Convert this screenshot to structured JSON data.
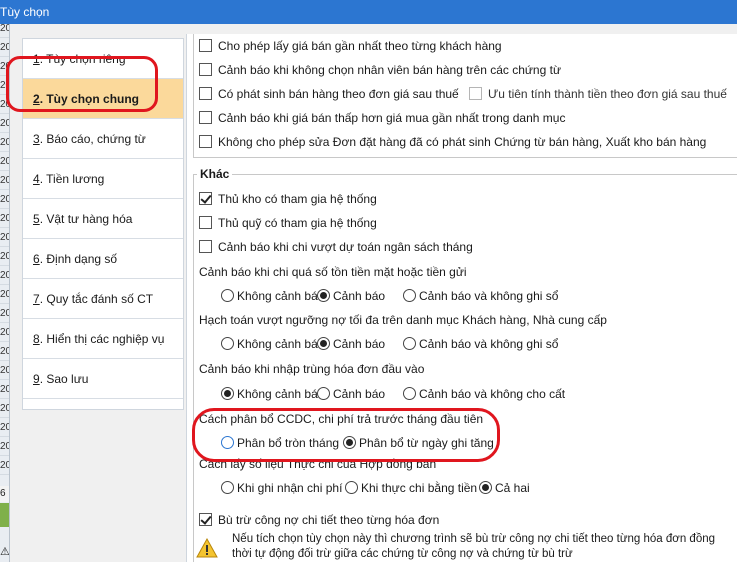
{
  "window": {
    "title": "Tùy chọn"
  },
  "background": {
    "cells": [
      "20",
      "20",
      "20",
      "20",
      "20",
      "20",
      "20",
      "20",
      "20",
      "20",
      "20",
      "20",
      "20",
      "20",
      "20",
      "20",
      "20",
      "20",
      "20",
      "20",
      "20",
      "20",
      "20",
      "20",
      "20"
    ],
    "number": "6"
  },
  "nav": {
    "items": [
      {
        "num": "1",
        "label": ". Tùy chọn riêng"
      },
      {
        "num": "2",
        "label": ". Tùy chọn chung"
      },
      {
        "num": "3",
        "label": ". Báo cáo, chứng từ"
      },
      {
        "num": "4",
        "label": ". Tiền lương"
      },
      {
        "num": "5",
        "label": ". Vật tư hàng hóa"
      },
      {
        "num": "6",
        "label": ". Định dạng số"
      },
      {
        "num": "7",
        "label": ". Quy tắc đánh số CT"
      },
      {
        "num": "8",
        "label": ". Hiển thị các nghiệp vụ"
      },
      {
        "num": "9",
        "label": ". Sao lưu"
      }
    ],
    "active_index": 1
  },
  "top_options": [
    {
      "label": "Cho phép lấy giá bán gần nhất theo từng khách hàng",
      "checked": false
    },
    {
      "label": "Cảnh báo khi không chọn nhân viên bán hàng trên các chứng từ",
      "checked": false
    },
    {
      "label": "Có phát sinh bán hàng theo đơn giá sau thuế",
      "checked": false
    },
    {
      "label": "Ưu tiên tính thành tiền theo đơn giá sau thuế",
      "checked": false,
      "disabled": true
    },
    {
      "label": "Cảnh báo khi giá bán thấp hơn giá mua gần nhất trong danh mục",
      "checked": false
    },
    {
      "label": "Không cho phép sửa Đơn đặt hàng đã có phát sinh Chứng từ bán hàng, Xuất kho bán hàng",
      "checked": false
    }
  ],
  "other": {
    "title": "Khác",
    "options": [
      {
        "label": "Thủ kho có tham gia hệ thống",
        "checked": true
      },
      {
        "label": "Thủ quỹ có tham gia hệ thống",
        "checked": false
      },
      {
        "label": "Cảnh báo khi chi vượt dự toán ngân sách tháng",
        "checked": false
      }
    ],
    "cash_warning": {
      "label": "Cảnh báo khi chi quá số tồn tiền mặt hoặc tiền gửi",
      "options": [
        "Không cảnh báo",
        "Cảnh báo",
        "Cảnh báo và không ghi sổ"
      ],
      "selected": 1
    },
    "debt_warning": {
      "label": "Hạch toán vượt ngưỡng nợ tối đa trên danh mục Khách hàng, Nhà cung cấp",
      "options": [
        "Không cảnh báo",
        "Cảnh báo",
        "Cảnh báo và không ghi sổ"
      ],
      "selected": 1
    },
    "invoice_warning": {
      "label": "Cảnh báo khi nhập trùng hóa đơn đầu vào",
      "options": [
        "Không cảnh báo",
        "Cảnh báo",
        "Cảnh báo và không cho cất"
      ],
      "selected": 0
    },
    "allocation": {
      "label": "Cách phân bổ CCDC, chi phí trả trước tháng đầu tiên",
      "options": [
        "Phân bổ tròn tháng",
        "Phân bổ từ ngày ghi tăng"
      ],
      "selected": 1
    },
    "contract": {
      "label": "Cách lấy số liệu Thực chi của Hợp đồng bán",
      "options": [
        "Khi ghi nhận chi phí",
        "Khi thực chi bằng tiền",
        "Cả hai"
      ],
      "selected": 2
    },
    "offset": {
      "label": "Bù trừ công nợ chi tiết theo từng hóa đơn",
      "checked": true
    },
    "note": "Nếu tích chọn tùy chọn này thì chương trình sẽ bù trừ công nợ chi tiết theo từng hóa đơn đồng thời tự động đối trừ giữa các chứng từ công nợ và chứng từ bù trừ"
  },
  "annotation_color": "#e0161e",
  "accent": "#2c76d1",
  "active_bg": "#fbd99b"
}
